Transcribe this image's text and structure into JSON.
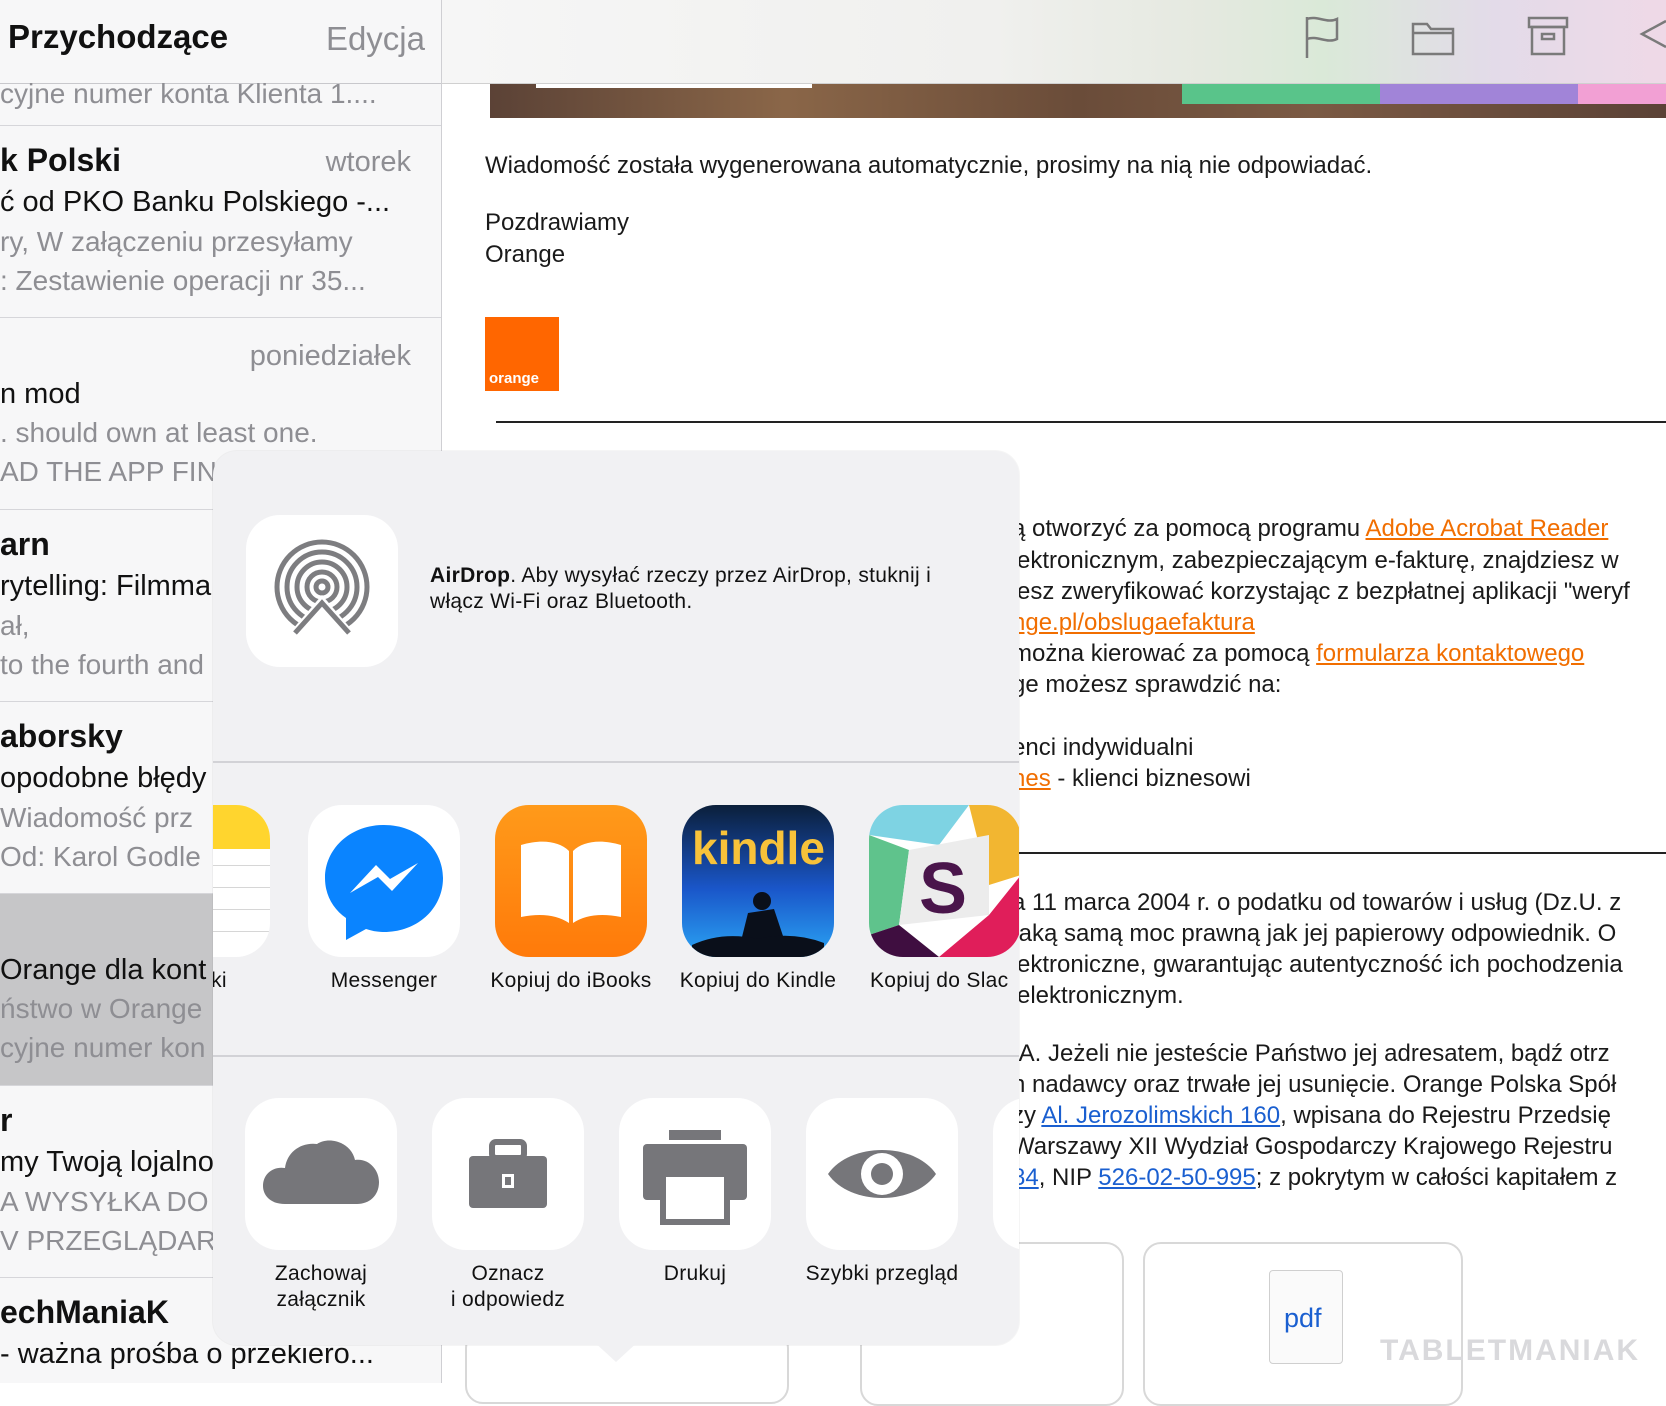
{
  "list": {
    "title": "Przychodzące",
    "edit_label": "Edycja",
    "rows": [
      {
        "preview": "cyjne numer konta Klienta 1...."
      },
      {
        "sender": "k Polski",
        "date": "wtorek",
        "subject": "ć od PKO Banku Polskiego -...",
        "preview1": "ry, W załączeniu przesyłamy",
        "preview2": ": Zestawienie operacji nr 35..."
      },
      {
        "date": "poniedziałek",
        "subject": "n mod",
        "preview1": ". should own at least one.",
        "preview2": "AD THE APP FIN"
      },
      {
        "sender": "arn",
        "subject": "rytelling: Filmma",
        "preview1": "ał,",
        "preview2": "to the fourth and"
      },
      {
        "sender": "aborsky",
        "subject": "opodobne błędy",
        "preview1": "Wiadomość prz",
        "preview2": "Od: Karol Godle"
      },
      {
        "subject": "Orange dla kont",
        "preview1": "ństwo w Orange",
        "preview2": "cyjne numer kon"
      },
      {
        "sender": "r",
        "subject": "my Twoją lojalno",
        "preview1": "A WYSYŁKA DO",
        "preview2": "V PRZEGLĄDAR"
      },
      {
        "sender": "echManiaK",
        "subject": "- ważna prośba o przekiero..."
      }
    ]
  },
  "toolbar": {
    "icons": [
      "flag-icon",
      "folder-icon",
      "archive-icon",
      "reply-icon"
    ]
  },
  "message": {
    "auto_note": "Wiadomość została wygenerowana automatycznie, prosimy na nią nie odpowiadać.",
    "greeting": "Pozdrawiamy",
    "signature": "Orange",
    "logo_text": "orange",
    "lines": {
      "l1a": "ą otworzyć za pomocą programu ",
      "l1_link": "Adobe Acrobat Reader",
      "l2": "ektronicznym, zabezpieczającym e-fakturę, znajdziesz w",
      "l3": "esz zweryfikować korzystając z bezpłatnej aplikacji \"weryf",
      "l4_link": "nge.pl/obslugaefaktura",
      "l5a": " można kierować za pomocą ",
      "l5_link": "formularza kontaktowego",
      "l6": "ge możesz sprawdzić na:",
      "l7": "enci indywidualni",
      "l8_link": "nes",
      "l8b": " - klienci biznesowi",
      "l9": "a 11 marca 2004 r. o podatku od towarów i usług (Dz.U. z",
      "l10": "taką samą moc prawną jak jej papierowy odpowiednik. O",
      "l11": "ektroniczne, gwarantując autentyczność ich pochodzenia",
      "l12": "elektronicznym.",
      "l13": ".A. Jeżeli nie jesteście Państwo jej adresatem, bądź otrz",
      "l14": "n nadawcy oraz trwałe jej usunięcie. Orange Polska Spół",
      "l15a": "zy ",
      "l15_link": "Al. Jerozolimskich 160",
      "l15b": ", wpisana do Rejestru Przedsię",
      "l16": "Warszawy XII Wydział Gospodarczy Krajowego Rejestru",
      "l17_link1": "84",
      "l17a": ", NIP ",
      "l17_link2": "526-02-50-995",
      "l17b": "; z pokrytym w całości kapitałem z"
    },
    "attachment_label": "pdf",
    "watermark": "TABLETMANIAK"
  },
  "share_sheet": {
    "airdrop_title": "AirDrop",
    "airdrop_text": ". Aby wysyłać rzeczy przez AirDrop, stuknij i włącz Wi-Fi oraz Bluetooth.",
    "apps": [
      {
        "label": "tki",
        "icon": "notes-icon"
      },
      {
        "label": "Messenger",
        "icon": "messenger-icon"
      },
      {
        "label": "Kopiuj do iBooks",
        "icon": "ibooks-icon"
      },
      {
        "label": "Kopiuj do Kindle",
        "icon": "kindle-icon",
        "icon_text": "kindle"
      },
      {
        "label": "Kopiuj do Slac",
        "icon": "slack-icon",
        "icon_text": "S"
      }
    ],
    "actions": [
      {
        "label1": "Zachowaj",
        "label2": "załącznik",
        "icon": "icloud-icon"
      },
      {
        "label1": "Oznacz",
        "label2": "i odpowiedz",
        "icon": "briefcase-icon"
      },
      {
        "label1": "Drukuj",
        "label2": "",
        "icon": "print-icon"
      },
      {
        "label1": "Szybki przegląd",
        "label2": "",
        "icon": "eye-icon"
      }
    ]
  },
  "colors": {
    "orange_brand": "#ff6600",
    "link_orange": "#f16e00",
    "link_blue": "#1a5fd0",
    "messenger": "#0a84ff"
  }
}
